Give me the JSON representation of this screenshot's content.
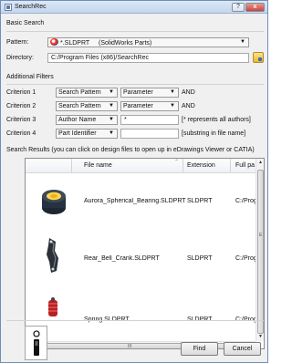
{
  "window": {
    "title": "SearchRec",
    "help_label": "?",
    "close_label": "x"
  },
  "basic_search": {
    "heading": "Basic Search",
    "pattern_label": "Pattern:",
    "pattern_value": "*.SLDPRT",
    "pattern_desc": "(SolidWorks Parts)",
    "directory_label": "Directory:",
    "directory_value": "C:/Program Files (x86)/SearchRec"
  },
  "additional_filters": {
    "heading": "Additional Filters",
    "criteria": [
      {
        "label": "Criterion 1",
        "field": "Search Pattern",
        "op": "Parameter",
        "value": "",
        "hint": "AND"
      },
      {
        "label": "Criterion 2",
        "field": "Search Pattern",
        "op": "Parameter",
        "value": "",
        "hint": "AND"
      },
      {
        "label": "Criterion 3",
        "field": "Author Name",
        "op": "",
        "value": "*",
        "hint": "[* represents all authors]"
      },
      {
        "label": "Criterion 4",
        "field": "Part Identifier",
        "op": "",
        "value": "",
        "hint": "[substring in file name]"
      }
    ]
  },
  "results": {
    "heading": "Search Results (you can click on design files to open up in eDrawings Viewer or CATIA)",
    "columns": [
      "File name",
      "Extension",
      "Full pa"
    ],
    "rows": [
      {
        "name": "Aurora_Spherical_Bearing.SLDPRT",
        "ext": "SLDPRT",
        "path": "C:/Prog"
      },
      {
        "name": "Rear_Bell_Crank.SLDPRT",
        "ext": "SLDPRT",
        "path": "C:/Prog"
      },
      {
        "name": "Spring.SLDPRT",
        "ext": "SLDPRT",
        "path": "C:/Prog"
      }
    ],
    "vscroll_mark": "E",
    "hscroll_grip": "III"
  },
  "footer": {
    "find_label": "Find",
    "cancel_label": "Cancel"
  },
  "colors": {
    "titlebar": "#c4d6ee",
    "close": "#c9433a",
    "window_bg": "#f0f0f0",
    "folder": "#eeb62a"
  }
}
